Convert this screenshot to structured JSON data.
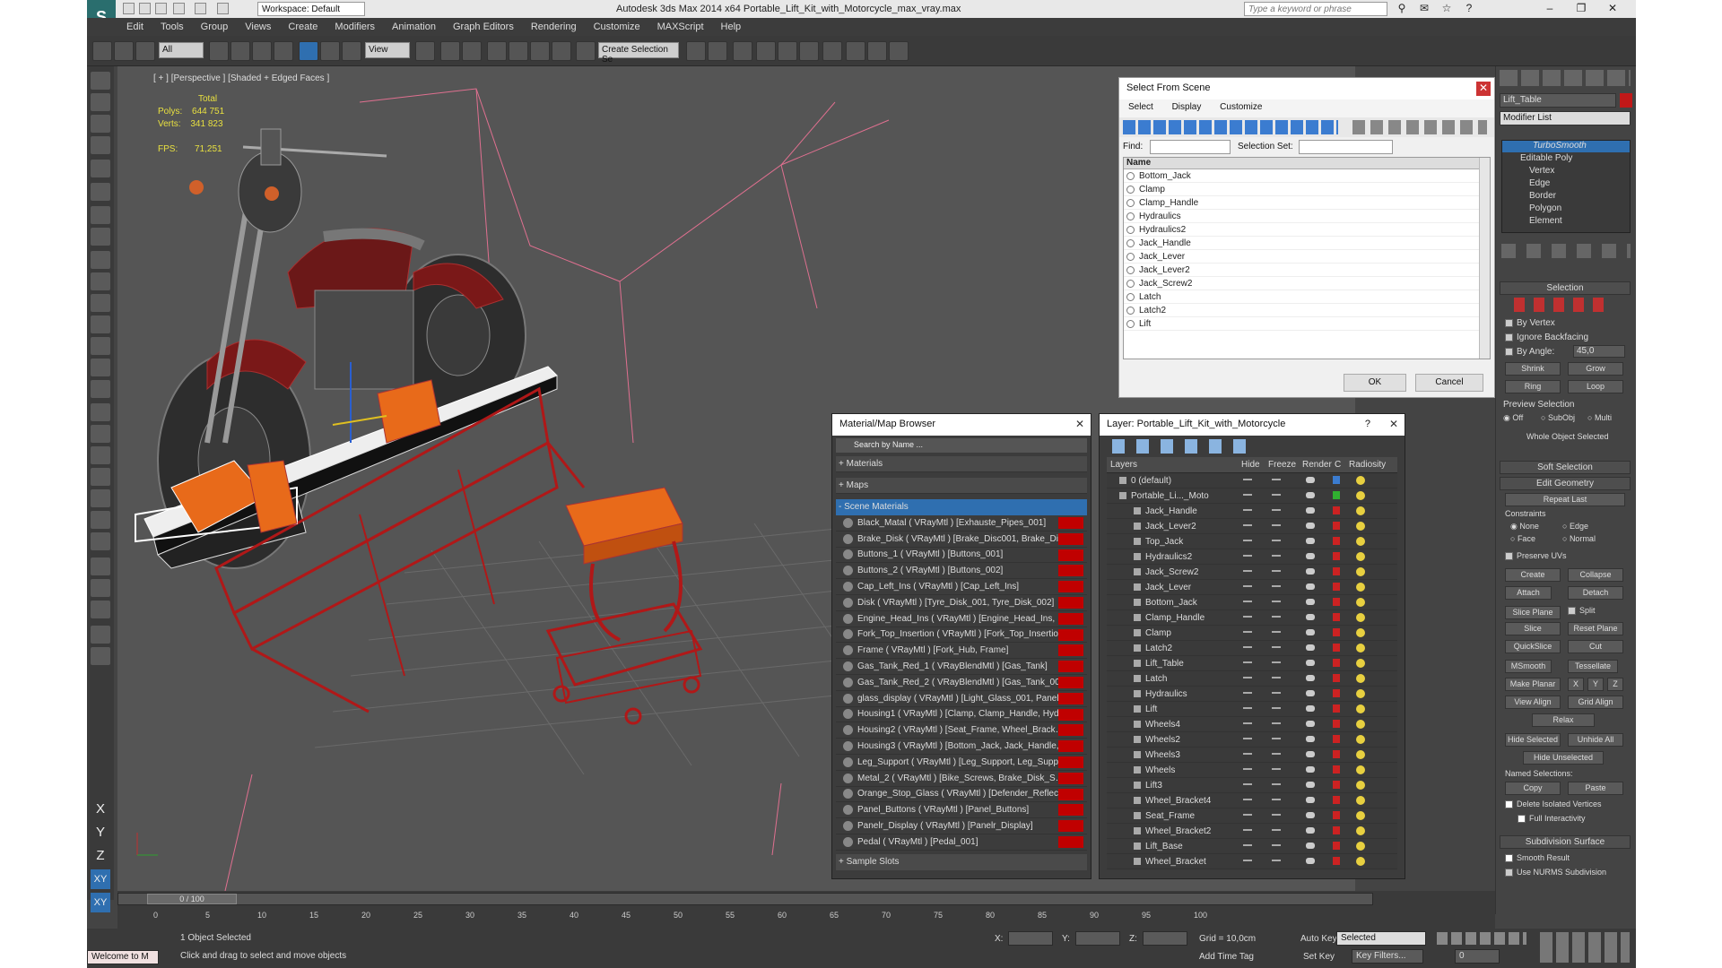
{
  "app": {
    "workspace": "Workspace: Default",
    "title": "Autodesk 3ds Max  2014 x64    Portable_Lift_Kit_with_Motorcycle_max_vray.max",
    "search_placeholder": "Type a keyword or phrase",
    "logo": "S"
  },
  "menu": [
    "Edit",
    "Tools",
    "Group",
    "Views",
    "Create",
    "Modifiers",
    "Animation",
    "Graph Editors",
    "Rendering",
    "Customize",
    "MAXScript",
    "Help"
  ],
  "toolbar": {
    "filter": "All",
    "ref_coord": "View",
    "selection_set": "Create Selection Se"
  },
  "viewport": {
    "label": "[ + ] [Perspective ] [Shaded + Edged Faces ]",
    "stats": {
      "total_label": "Total",
      "polys_label": "Polys:",
      "polys": "644 751",
      "verts_label": "Verts:",
      "verts": "341 823",
      "fps_label": "FPS:",
      "fps": "71,251"
    }
  },
  "left_axes": [
    "X",
    "Y",
    "Z",
    "XY",
    "XY"
  ],
  "select_from_scene": {
    "title": "Select From Scene",
    "tabs": [
      "Select",
      "Display",
      "Customize"
    ],
    "find_label": "Find:",
    "selection_set_label": "Selection Set:",
    "column_name": "Name",
    "items": [
      "Bottom_Jack",
      "Clamp",
      "Clamp_Handle",
      "Hydraulics",
      "Hydraulics2",
      "Jack_Handle",
      "Jack_Lever",
      "Jack_Lever2",
      "Jack_Screw2",
      "Latch",
      "Latch2",
      "Lift"
    ],
    "ok": "OK",
    "cancel": "Cancel"
  },
  "material_browser": {
    "title": "Material/Map Browser",
    "search_placeholder": "Search by Name ...",
    "sections": [
      "+ Materials",
      "+ Maps",
      "- Scene Materials"
    ],
    "sample_slots": "+ Sample Slots",
    "items": [
      "Black_Matal  ( VRayMtl ) [Exhauste_Pipes_001]",
      "Brake_Disk  ( VRayMtl ) [Brake_Disc001, Brake_Disk]",
      "Buttons_1  ( VRayMtl ) [Buttons_001]",
      "Buttons_2  ( VRayMtl ) [Buttons_002]",
      "Cap_Left_Ins  ( VRayMtl ) [Cap_Left_Ins]",
      "Disk  ( VRayMtl ) [Tyre_Disk_001, Tyre_Disk_002]",
      "Engine_Head_Ins  ( VRayMtl ) [Engine_Head_Ins, Engine_Head...",
      "Fork_Top_Insertion  ( VRayMtl ) [Fork_Top_Insertion]",
      "Frame  ( VRayMtl ) [Fork_Hub, Frame]",
      "Gas_Tank_Red_1  ( VRayBlendMtl ) [Gas_Tank]",
      "Gas_Tank_Red_2  ( VRayBlendMtl ) [Gas_Tank_002]",
      "glass_display  ( VRayMtl ) [Light_Glass_001, Panel_Glass_001,...",
      "Housing1  ( VRayMtl ) [Clamp, Clamp_Handle, Hydraulics, Hydr...",
      "Housing2  ( VRayMtl ) [Seat_Frame, Wheel_Bracket, Wheel_Bra...",
      "Housing3  ( VRayMtl ) [Bottom_Jack, Jack_Handle, Jack_Lever,...",
      "Leg_Support  ( VRayMtl ) [Leg_Support, Leg_Support001]",
      "Metal_2  ( VRayMtl ) [Bike_Screws, Brake_Disk_Screws_001, Br...",
      "Orange_Stop_Glass  ( VRayMtl ) [Defender_Reflector_Glass, De...",
      "Panel_Buttons  ( VRayMtl ) [Panel_Buttons]",
      "Panelr_Display  ( VRayMtl ) [Panelr_Display]",
      "Pedal  ( VRayMtl ) [Pedal_001]"
    ]
  },
  "layers": {
    "title": "Layer: Portable_Lift_Kit_with_Motorcycle",
    "help": "?",
    "columns": [
      "Layers",
      "Hide",
      "Freeze",
      "Render",
      "C",
      "Radiosity"
    ],
    "items": [
      "0 (default)",
      "Portable_Li..._Moto",
      "Jack_Handle",
      "Jack_Lever2",
      "Top_Jack",
      "Hydraulics2",
      "Jack_Screw2",
      "Jack_Lever",
      "Bottom_Jack",
      "Clamp_Handle",
      "Clamp",
      "Latch2",
      "Lift_Table",
      "Latch",
      "Hydraulics",
      "Lift",
      "Wheels4",
      "Wheels2",
      "Wheels3",
      "Wheels",
      "Lift3",
      "Wheel_Bracket4",
      "Seat_Frame",
      "Wheel_Bracket2",
      "Lift_Base",
      "Wheel_Bracket"
    ]
  },
  "command_panel": {
    "object_name": "Lift_Table",
    "modifier_list": "Modifier List",
    "stack": [
      "TurboSmooth",
      "Editable Poly",
      "Vertex",
      "Edge",
      "Border",
      "Polygon",
      "Element"
    ],
    "selection_head": "Selection",
    "by_vertex": "By Vertex",
    "ignore_backfacing": "Ignore Backfacing",
    "by_angle": "By Angle:",
    "angle_value": "45,0",
    "shrink": "Shrink",
    "grow": "Grow",
    "ring": "Ring",
    "loop": "Loop",
    "preview_selection": "Preview Selection",
    "preview_opts": [
      "Off",
      "SubObj",
      "Multi"
    ],
    "whole_selected": "Whole Object Selected",
    "soft_selection": "Soft Selection",
    "edit_geometry": "Edit Geometry",
    "repeat_last": "Repeat Last",
    "constraints": "Constraints",
    "constraint_opts": [
      "None",
      "Edge",
      "Face",
      "Normal"
    ],
    "preserve_uvs": "Preserve UVs",
    "buttons": [
      "Create",
      "Collapse",
      "Attach",
      "Detach",
      "Slice Plane",
      "Split",
      "Slice",
      "Reset Plane",
      "QuickSlice",
      "Cut",
      "MSmooth",
      "Tessellate",
      "Make Planar",
      "X",
      "Y",
      "Z",
      "View Align",
      "Grid Align",
      "Relax",
      "Hide Selected",
      "Unhide All",
      "Hide Unselected",
      "Copy",
      "Paste"
    ],
    "named_selections": "Named Selections:",
    "delete_isolated": "Delete Isolated Vertices",
    "full_interactivity": "Full Interactivity",
    "subdivision_surface": "Subdivision Surface",
    "smooth_result": "Smooth Result",
    "use_nurms": "Use NURMS Subdivision"
  },
  "timeline": {
    "frame_label": "0 / 100",
    "ticks": [
      "0",
      "5",
      "10",
      "15",
      "20",
      "25",
      "30",
      "35",
      "40",
      "45",
      "50",
      "55",
      "60",
      "65",
      "70",
      "75",
      "80",
      "85",
      "90",
      "95",
      "100"
    ]
  },
  "status": {
    "welcome": "Welcome to M",
    "selected": "1 Object Selected",
    "hint": "Click and drag to select and move objects",
    "x_label": "X:",
    "y_label": "Y:",
    "z_label": "Z:",
    "grid": "Grid = 10,0cm",
    "add_time_tag": "Add Time Tag",
    "auto_key": "Auto Key",
    "set_key": "Set Key",
    "selected_mode": "Selected",
    "key_filters": "Key Filters...",
    "frame": "0"
  },
  "colors": {
    "accent": "#2f6fb0",
    "mat_red": "#c00000",
    "layer_red": "#cc2222",
    "wire_red": "#b01818",
    "wire_orange": "#e86a1a"
  }
}
